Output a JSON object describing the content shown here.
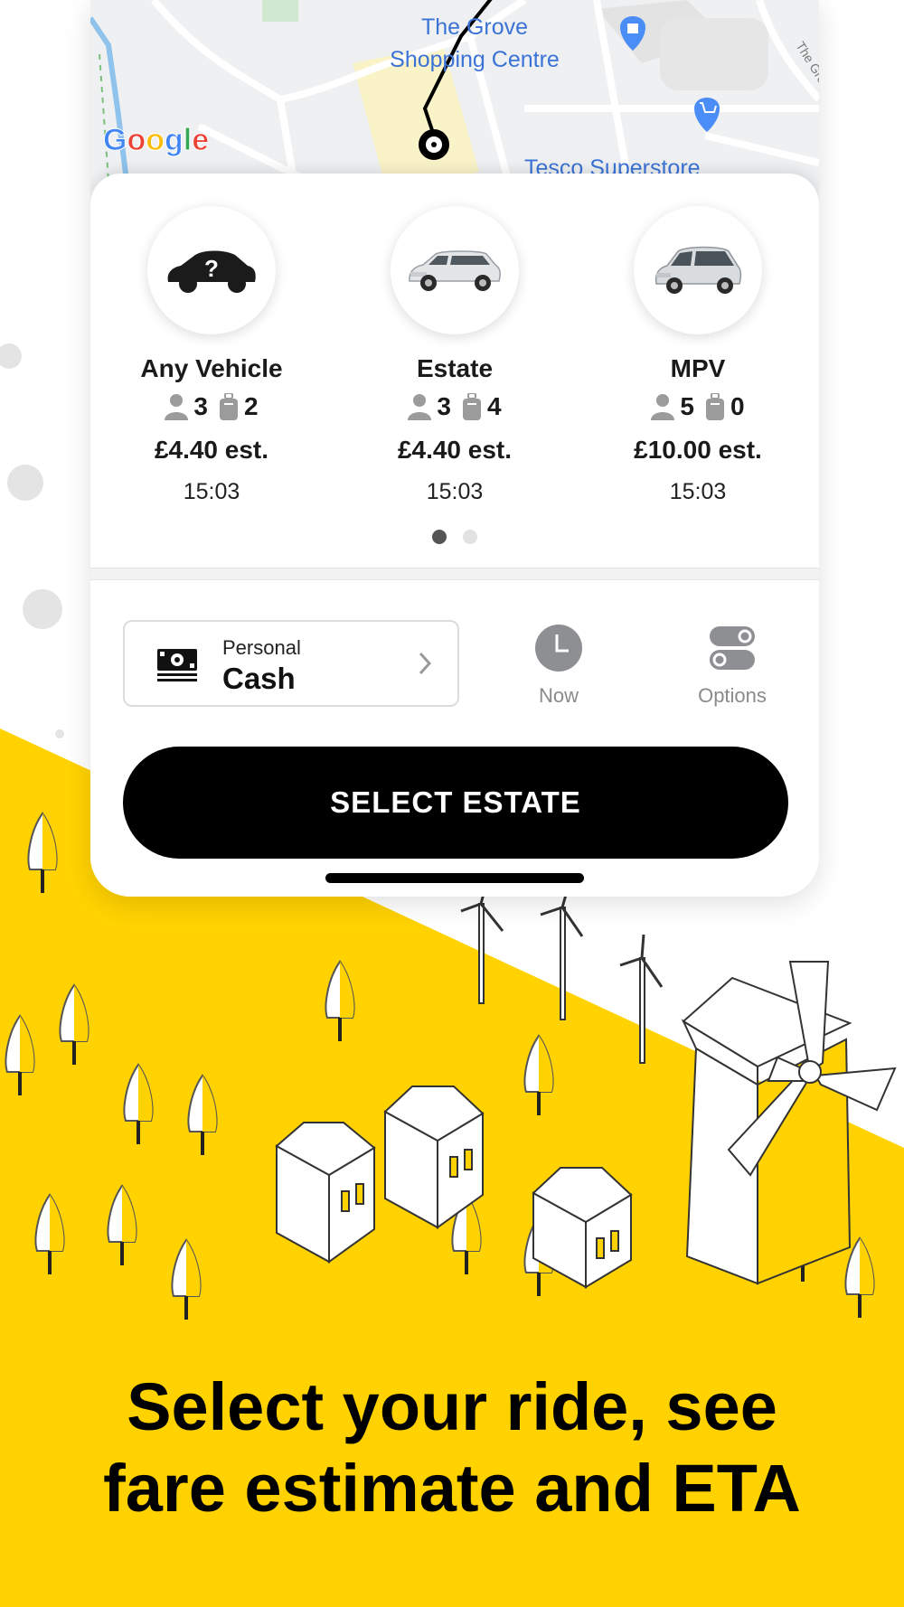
{
  "map": {
    "labels": {
      "grove": [
        "The Grove",
        "Shopping Centre"
      ],
      "tesco": "Tesco Superstore",
      "road": "The Grove"
    },
    "google_logo": "Google"
  },
  "vehicles": [
    {
      "name": "Any Vehicle",
      "passengers": "3",
      "luggage": "2",
      "price": "£4.40 est.",
      "eta": "15:03",
      "icon": "unknown-car-icon"
    },
    {
      "name": "Estate",
      "passengers": "3",
      "luggage": "4",
      "price": "£4.40 est.",
      "eta": "15:03",
      "icon": "estate-car-icon"
    },
    {
      "name": "MPV",
      "passengers": "5",
      "luggage": "0",
      "price": "£10.00 est.",
      "eta": "15:03",
      "icon": "mpv-car-icon"
    }
  ],
  "pager": {
    "pages": 2,
    "active": 1
  },
  "payment": {
    "type": "Personal",
    "method": "Cash"
  },
  "controls": {
    "time_label": "Now",
    "options_label": "Options"
  },
  "select_button": "SELECT ESTATE",
  "headline": {
    "line1": "Select your ride, see",
    "line2": "fare estimate and ETA"
  },
  "colors": {
    "brand_yellow": "#FFD200",
    "button": "#000000",
    "map_label_blue": "#3b73d6",
    "google_blue": "#4285F4",
    "google_red": "#EA4335",
    "google_yellow": "#FBBC05",
    "google_green": "#34A853"
  }
}
